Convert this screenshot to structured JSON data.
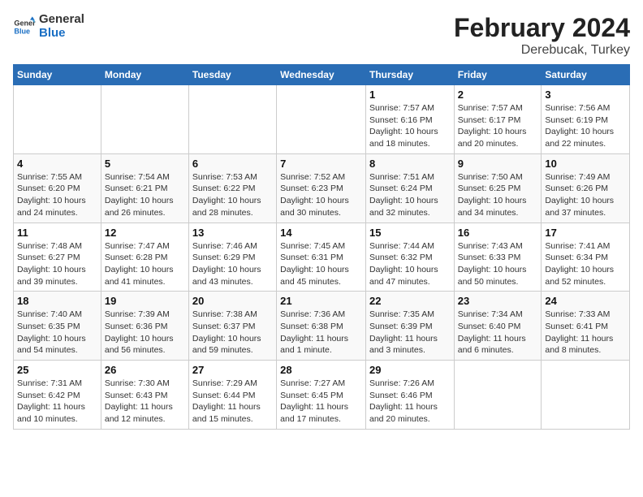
{
  "logo": {
    "line1": "General",
    "line2": "Blue"
  },
  "title": "February 2024",
  "subtitle": "Derebucak, Turkey",
  "weekdays": [
    "Sunday",
    "Monday",
    "Tuesday",
    "Wednesday",
    "Thursday",
    "Friday",
    "Saturday"
  ],
  "weeks": [
    [
      {
        "day": "",
        "detail": ""
      },
      {
        "day": "",
        "detail": ""
      },
      {
        "day": "",
        "detail": ""
      },
      {
        "day": "",
        "detail": ""
      },
      {
        "day": "1",
        "detail": "Sunrise: 7:57 AM\nSunset: 6:16 PM\nDaylight: 10 hours\nand 18 minutes."
      },
      {
        "day": "2",
        "detail": "Sunrise: 7:57 AM\nSunset: 6:17 PM\nDaylight: 10 hours\nand 20 minutes."
      },
      {
        "day": "3",
        "detail": "Sunrise: 7:56 AM\nSunset: 6:19 PM\nDaylight: 10 hours\nand 22 minutes."
      }
    ],
    [
      {
        "day": "4",
        "detail": "Sunrise: 7:55 AM\nSunset: 6:20 PM\nDaylight: 10 hours\nand 24 minutes."
      },
      {
        "day": "5",
        "detail": "Sunrise: 7:54 AM\nSunset: 6:21 PM\nDaylight: 10 hours\nand 26 minutes."
      },
      {
        "day": "6",
        "detail": "Sunrise: 7:53 AM\nSunset: 6:22 PM\nDaylight: 10 hours\nand 28 minutes."
      },
      {
        "day": "7",
        "detail": "Sunrise: 7:52 AM\nSunset: 6:23 PM\nDaylight: 10 hours\nand 30 minutes."
      },
      {
        "day": "8",
        "detail": "Sunrise: 7:51 AM\nSunset: 6:24 PM\nDaylight: 10 hours\nand 32 minutes."
      },
      {
        "day": "9",
        "detail": "Sunrise: 7:50 AM\nSunset: 6:25 PM\nDaylight: 10 hours\nand 34 minutes."
      },
      {
        "day": "10",
        "detail": "Sunrise: 7:49 AM\nSunset: 6:26 PM\nDaylight: 10 hours\nand 37 minutes."
      }
    ],
    [
      {
        "day": "11",
        "detail": "Sunrise: 7:48 AM\nSunset: 6:27 PM\nDaylight: 10 hours\nand 39 minutes."
      },
      {
        "day": "12",
        "detail": "Sunrise: 7:47 AM\nSunset: 6:28 PM\nDaylight: 10 hours\nand 41 minutes."
      },
      {
        "day": "13",
        "detail": "Sunrise: 7:46 AM\nSunset: 6:29 PM\nDaylight: 10 hours\nand 43 minutes."
      },
      {
        "day": "14",
        "detail": "Sunrise: 7:45 AM\nSunset: 6:31 PM\nDaylight: 10 hours\nand 45 minutes."
      },
      {
        "day": "15",
        "detail": "Sunrise: 7:44 AM\nSunset: 6:32 PM\nDaylight: 10 hours\nand 47 minutes."
      },
      {
        "day": "16",
        "detail": "Sunrise: 7:43 AM\nSunset: 6:33 PM\nDaylight: 10 hours\nand 50 minutes."
      },
      {
        "day": "17",
        "detail": "Sunrise: 7:41 AM\nSunset: 6:34 PM\nDaylight: 10 hours\nand 52 minutes."
      }
    ],
    [
      {
        "day": "18",
        "detail": "Sunrise: 7:40 AM\nSunset: 6:35 PM\nDaylight: 10 hours\nand 54 minutes."
      },
      {
        "day": "19",
        "detail": "Sunrise: 7:39 AM\nSunset: 6:36 PM\nDaylight: 10 hours\nand 56 minutes."
      },
      {
        "day": "20",
        "detail": "Sunrise: 7:38 AM\nSunset: 6:37 PM\nDaylight: 10 hours\nand 59 minutes."
      },
      {
        "day": "21",
        "detail": "Sunrise: 7:36 AM\nSunset: 6:38 PM\nDaylight: 11 hours\nand 1 minute."
      },
      {
        "day": "22",
        "detail": "Sunrise: 7:35 AM\nSunset: 6:39 PM\nDaylight: 11 hours\nand 3 minutes."
      },
      {
        "day": "23",
        "detail": "Sunrise: 7:34 AM\nSunset: 6:40 PM\nDaylight: 11 hours\nand 6 minutes."
      },
      {
        "day": "24",
        "detail": "Sunrise: 7:33 AM\nSunset: 6:41 PM\nDaylight: 11 hours\nand 8 minutes."
      }
    ],
    [
      {
        "day": "25",
        "detail": "Sunrise: 7:31 AM\nSunset: 6:42 PM\nDaylight: 11 hours\nand 10 minutes."
      },
      {
        "day": "26",
        "detail": "Sunrise: 7:30 AM\nSunset: 6:43 PM\nDaylight: 11 hours\nand 12 minutes."
      },
      {
        "day": "27",
        "detail": "Sunrise: 7:29 AM\nSunset: 6:44 PM\nDaylight: 11 hours\nand 15 minutes."
      },
      {
        "day": "28",
        "detail": "Sunrise: 7:27 AM\nSunset: 6:45 PM\nDaylight: 11 hours\nand 17 minutes."
      },
      {
        "day": "29",
        "detail": "Sunrise: 7:26 AM\nSunset: 6:46 PM\nDaylight: 11 hours\nand 20 minutes."
      },
      {
        "day": "",
        "detail": ""
      },
      {
        "day": "",
        "detail": ""
      }
    ]
  ]
}
